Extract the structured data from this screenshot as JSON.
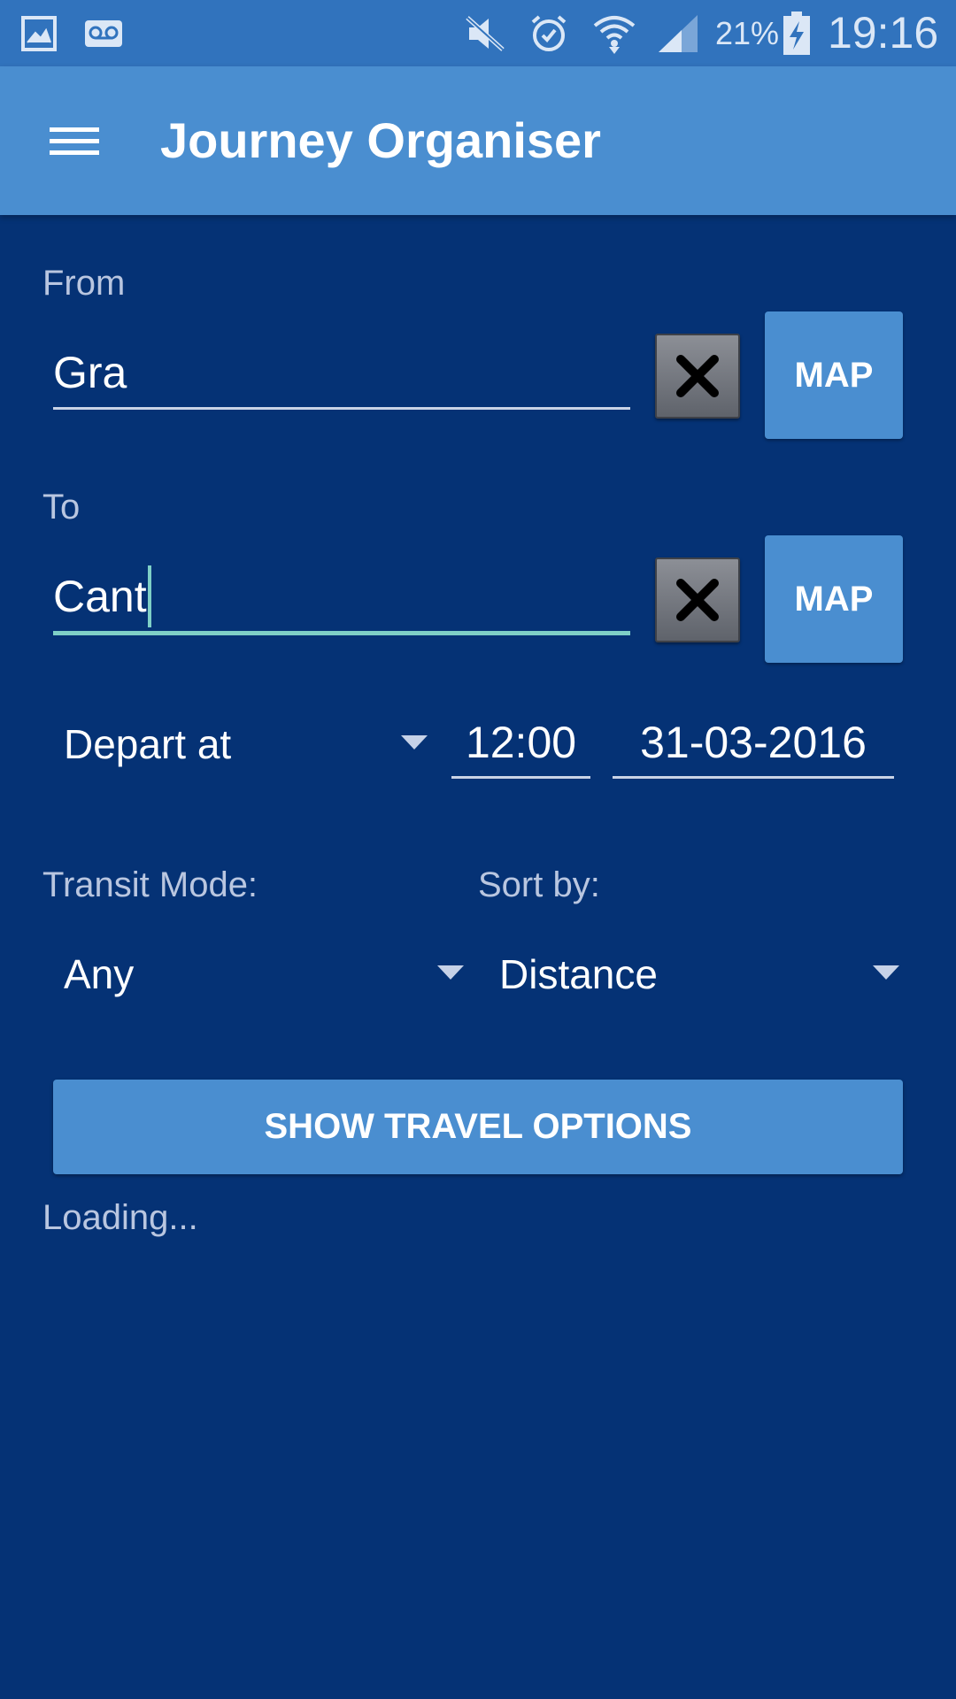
{
  "status_bar": {
    "battery_percent": "21%",
    "time": "19:16",
    "icons": [
      "gallery-icon",
      "voicemail-icon",
      "mute-icon",
      "alarm-icon",
      "wifi-icon",
      "signal-icon",
      "battery-charging-icon"
    ]
  },
  "app_bar": {
    "title": "Journey Organiser",
    "menu_icon": "hamburger-menu-icon"
  },
  "from": {
    "label": "From",
    "value": "Gra",
    "clear_icon": "close-icon",
    "map_label": "MAP"
  },
  "to": {
    "label": "To",
    "value": "Cant",
    "clear_icon": "close-icon",
    "map_label": "MAP"
  },
  "timing": {
    "mode": "Depart at",
    "time": "12:00",
    "date": "31-03-2016"
  },
  "transit": {
    "label": "Transit Mode:",
    "value": "Any"
  },
  "sort": {
    "label": "Sort by:",
    "value": "Distance"
  },
  "actions": {
    "show_options_label": "SHOW TRAVEL OPTIONS"
  },
  "status": {
    "loading_text": "Loading..."
  },
  "colors": {
    "background": "#053275",
    "app_bar": "#4a8ed0",
    "status_bar": "#3173bd",
    "accent": "#7fd0c7"
  }
}
